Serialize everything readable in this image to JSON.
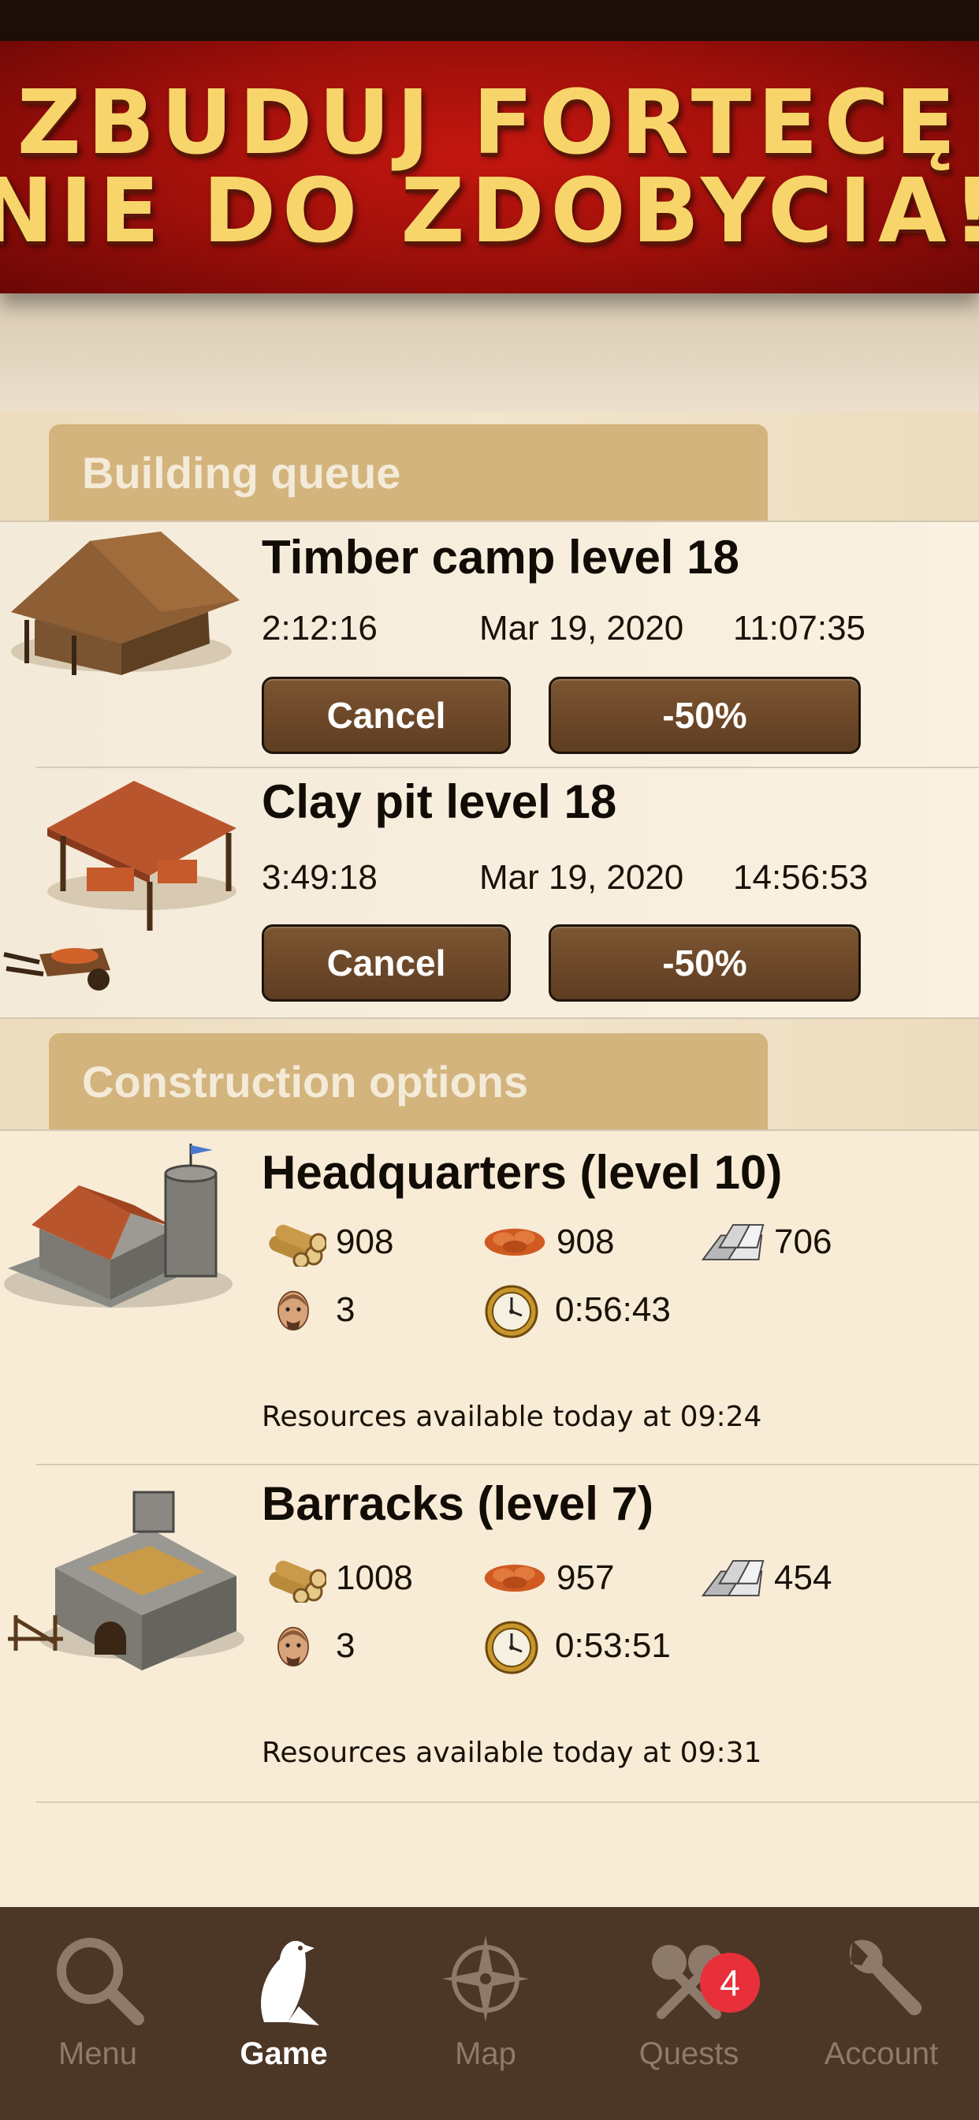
{
  "banner": {
    "line1": "ZBUDUJ FORTECĘ",
    "line2": "NIE DO ZDOBYCIA!"
  },
  "building_queue": {
    "header": "Building queue",
    "items": [
      {
        "title": "Timber camp level 18",
        "remaining": "2:12:16",
        "date": "Mar 19, 2020",
        "time": "11:07:35",
        "cancel_label": "Cancel",
        "speedup_label": "-50%"
      },
      {
        "title": "Clay pit level 18",
        "remaining": "3:49:18",
        "date": "Mar 19, 2020",
        "time": "14:56:53",
        "cancel_label": "Cancel",
        "speedup_label": "-50%"
      }
    ]
  },
  "construction_options": {
    "header": "Construction options",
    "items": [
      {
        "title": "Headquarters (level 10)",
        "wood": "908",
        "clay": "908",
        "iron": "706",
        "population": "3",
        "build_time": "0:56:43",
        "availability": "Resources available today at 09:24"
      },
      {
        "title": "Barracks (level 7)",
        "wood": "1008",
        "clay": "957",
        "iron": "454",
        "population": "3",
        "build_time": "0:53:51",
        "availability": "Resources available today at 09:31"
      }
    ]
  },
  "nav": {
    "items": [
      {
        "label": "Menu",
        "icon": "magnifier-icon",
        "active": false
      },
      {
        "label": "Game",
        "icon": "bird-icon",
        "active": true
      },
      {
        "label": "Map",
        "icon": "compass-icon",
        "active": false
      },
      {
        "label": "Quests",
        "icon": "quests-icon",
        "active": false,
        "badge": "4"
      },
      {
        "label": "Account",
        "icon": "wrench-icon",
        "active": false
      }
    ]
  },
  "colors": {
    "banner_red": "#b3130d",
    "banner_text": "#f7d56b",
    "button_brown": "#6e4a2a",
    "section_tab": "#d3b47d",
    "nav_bg": "#4c3626",
    "badge_red": "#e8303a"
  }
}
